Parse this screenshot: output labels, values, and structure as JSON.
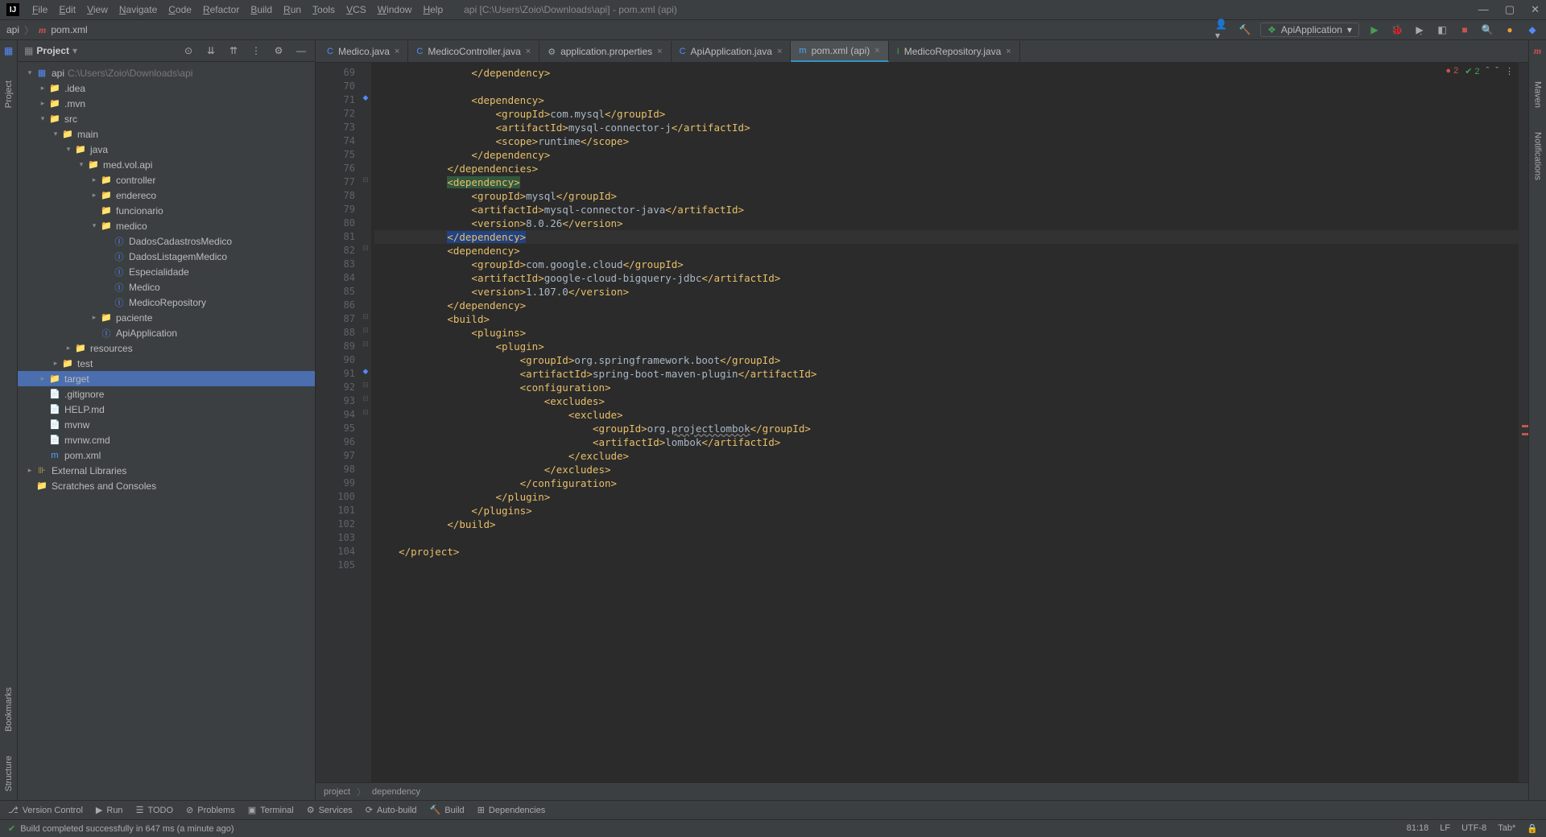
{
  "menu": [
    "File",
    "Edit",
    "View",
    "Navigate",
    "Code",
    "Refactor",
    "Build",
    "Run",
    "Tools",
    "VCS",
    "Window",
    "Help"
  ],
  "window_title": "api [C:\\Users\\Zoio\\Downloads\\api] - pom.xml (api)",
  "breadcrumb_top": {
    "root": "api",
    "file": "pom.xml"
  },
  "run_config": "ApiApplication",
  "project_panel_title": "Project",
  "tree": [
    {
      "d": 0,
      "a": "v",
      "i": "mod",
      "l": "api",
      "p": "C:\\Users\\Zoio\\Downloads\\api"
    },
    {
      "d": 1,
      "a": ">",
      "i": "folder",
      "l": ".idea"
    },
    {
      "d": 1,
      "a": ">",
      "i": "folder",
      "l": ".mvn"
    },
    {
      "d": 1,
      "a": "v",
      "i": "src",
      "l": "src"
    },
    {
      "d": 2,
      "a": "v",
      "i": "src",
      "l": "main"
    },
    {
      "d": 3,
      "a": "v",
      "i": "src",
      "l": "java"
    },
    {
      "d": 4,
      "a": "v",
      "i": "pkg",
      "l": "med.vol.api"
    },
    {
      "d": 5,
      "a": ">",
      "i": "pkg",
      "l": "controller"
    },
    {
      "d": 5,
      "a": ">",
      "i": "pkg",
      "l": "endereco"
    },
    {
      "d": 5,
      "a": "",
      "i": "pkg",
      "l": "funcionario"
    },
    {
      "d": 5,
      "a": "v",
      "i": "pkg",
      "l": "medico"
    },
    {
      "d": 6,
      "a": "",
      "i": "java",
      "l": "DadosCadastrosMedico"
    },
    {
      "d": 6,
      "a": "",
      "i": "java",
      "l": "DadosListagemMedico"
    },
    {
      "d": 6,
      "a": "",
      "i": "java",
      "l": "Especialidade"
    },
    {
      "d": 6,
      "a": "",
      "i": "java",
      "l": "Medico"
    },
    {
      "d": 6,
      "a": "",
      "i": "java",
      "l": "MedicoRepository"
    },
    {
      "d": 5,
      "a": ">",
      "i": "pkg",
      "l": "paciente"
    },
    {
      "d": 5,
      "a": "",
      "i": "java",
      "l": "ApiApplication"
    },
    {
      "d": 3,
      "a": ">",
      "i": "res",
      "l": "resources"
    },
    {
      "d": 2,
      "a": ">",
      "i": "src",
      "l": "test"
    },
    {
      "d": 1,
      "a": ">",
      "i": "target",
      "l": "target",
      "sel": true
    },
    {
      "d": 1,
      "a": "",
      "i": "file",
      "l": ".gitignore"
    },
    {
      "d": 1,
      "a": "",
      "i": "md",
      "l": "HELP.md"
    },
    {
      "d": 1,
      "a": "",
      "i": "file",
      "l": "mvnw"
    },
    {
      "d": 1,
      "a": "",
      "i": "file",
      "l": "mvnw.cmd"
    },
    {
      "d": 1,
      "a": "",
      "i": "xml",
      "l": "pom.xml"
    },
    {
      "d": 0,
      "a": ">",
      "i": "lib",
      "l": "External Libraries"
    },
    {
      "d": 0,
      "a": "",
      "i": "scratch",
      "l": "Scratches and Consoles"
    }
  ],
  "tabs": [
    {
      "label": "Medico.java",
      "icon": "C",
      "color": "#548af7"
    },
    {
      "label": "MedicoController.java",
      "icon": "C",
      "color": "#548af7"
    },
    {
      "label": "application.properties",
      "icon": "⚙",
      "color": "#9aa"
    },
    {
      "label": "ApiApplication.java",
      "icon": "C",
      "color": "#548af7"
    },
    {
      "label": "pom.xml (api)",
      "icon": "m",
      "color": "#4da6ff",
      "active": true
    },
    {
      "label": "MedicoRepository.java",
      "icon": "I",
      "color": "#499c54"
    }
  ],
  "code_start": 69,
  "code": [
    {
      "n": 69,
      "indent": 4,
      "type": "ctag",
      "t": "dependency"
    },
    {
      "n": 70,
      "indent": 0,
      "blank": true
    },
    {
      "n": 71,
      "indent": 4,
      "type": "otag",
      "t": "dependency",
      "mark": "◆"
    },
    {
      "n": 72,
      "indent": 5,
      "type": "wrap",
      "t": "groupId",
      "c": "com.mysql"
    },
    {
      "n": 73,
      "indent": 5,
      "type": "wrap",
      "t": "artifactId",
      "c": "mysql-connector-j"
    },
    {
      "n": 74,
      "indent": 5,
      "type": "wrap",
      "t": "scope",
      "c": "runtime"
    },
    {
      "n": 75,
      "indent": 4,
      "type": "ctag",
      "t": "dependency"
    },
    {
      "n": 76,
      "indent": 3,
      "type": "ctag",
      "t": "dependencies"
    },
    {
      "n": 77,
      "indent": 3,
      "type": "otag",
      "t": "dependency",
      "hl": "green"
    },
    {
      "n": 78,
      "indent": 4,
      "type": "wrap",
      "t": "groupId",
      "c": "mysql"
    },
    {
      "n": 79,
      "indent": 4,
      "type": "wrap",
      "t": "artifactId",
      "c": "mysql-connector-java"
    },
    {
      "n": 80,
      "indent": 4,
      "type": "wrap",
      "t": "version",
      "c": "8.0.26"
    },
    {
      "n": 81,
      "indent": 3,
      "type": "ctag",
      "t": "dependency",
      "hl": "blue",
      "bulb": true,
      "cursor": true
    },
    {
      "n": 82,
      "indent": 3,
      "type": "otag",
      "t": "dependency"
    },
    {
      "n": 83,
      "indent": 4,
      "type": "wrap",
      "t": "groupId",
      "c": "com.google.cloud"
    },
    {
      "n": 84,
      "indent": 4,
      "type": "wrap",
      "t": "artifactId",
      "c": "google-cloud-bigquery-jdbc"
    },
    {
      "n": 85,
      "indent": 4,
      "type": "wrap",
      "t": "version",
      "c": "1.107.0"
    },
    {
      "n": 86,
      "indent": 3,
      "type": "ctag",
      "t": "dependency"
    },
    {
      "n": 87,
      "indent": 3,
      "type": "otag",
      "t": "build"
    },
    {
      "n": 88,
      "indent": 4,
      "type": "otag",
      "t": "plugins"
    },
    {
      "n": 89,
      "indent": 5,
      "type": "otag",
      "t": "plugin"
    },
    {
      "n": 90,
      "indent": 6,
      "type": "wrap",
      "t": "groupId",
      "c": "org.springframework.boot"
    },
    {
      "n": 91,
      "indent": 6,
      "type": "wrap",
      "t": "artifactId",
      "c": "spring-boot-maven-plugin",
      "mark": "◆"
    },
    {
      "n": 92,
      "indent": 6,
      "type": "otag",
      "t": "configuration"
    },
    {
      "n": 93,
      "indent": 7,
      "type": "otag",
      "t": "excludes"
    },
    {
      "n": 94,
      "indent": 8,
      "type": "otag",
      "t": "exclude"
    },
    {
      "n": 95,
      "indent": 9,
      "type": "wrap",
      "t": "groupId",
      "c": "org.",
      "c2": "projectlombok",
      "warn": true
    },
    {
      "n": 96,
      "indent": 9,
      "type": "wrap",
      "t": "artifactId",
      "c": "lombok"
    },
    {
      "n": 97,
      "indent": 8,
      "type": "ctag",
      "t": "exclude"
    },
    {
      "n": 98,
      "indent": 7,
      "type": "ctag",
      "t": "excludes"
    },
    {
      "n": 99,
      "indent": 6,
      "type": "ctag",
      "t": "configuration"
    },
    {
      "n": 100,
      "indent": 5,
      "type": "ctag",
      "t": "plugin"
    },
    {
      "n": 101,
      "indent": 4,
      "type": "ctag",
      "t": "plugins"
    },
    {
      "n": 102,
      "indent": 3,
      "type": "ctag",
      "t": "build"
    },
    {
      "n": 103,
      "indent": 0,
      "blank": true
    },
    {
      "n": 104,
      "indent": 1,
      "type": "ctag",
      "t": "project"
    },
    {
      "n": 105,
      "indent": 0,
      "blank": true
    }
  ],
  "inspection": {
    "errors": "2",
    "ok": "2"
  },
  "breadcrumb_bottom": [
    "project",
    "dependency"
  ],
  "bottom_tools": [
    {
      "i": "⎇",
      "l": "Version Control"
    },
    {
      "i": "▶",
      "l": "Run"
    },
    {
      "i": "☰",
      "l": "TODO"
    },
    {
      "i": "⊘",
      "l": "Problems"
    },
    {
      "i": "▣",
      "l": "Terminal"
    },
    {
      "i": "⚙",
      "l": "Services"
    },
    {
      "i": "⟳",
      "l": "Auto-build"
    },
    {
      "i": "🔨",
      "l": "Build"
    },
    {
      "i": "⊞",
      "l": "Dependencies"
    }
  ],
  "status_msg": "Build completed successfully in 647 ms (a minute ago)",
  "status_right": {
    "pos": "81:18",
    "lf": "LF",
    "enc": "UTF-8",
    "tab": "Tab*"
  },
  "side_tools_left": [
    "Project",
    "Bookmarks",
    "Structure"
  ],
  "side_tools_right": [
    "Maven",
    "Notifications"
  ]
}
